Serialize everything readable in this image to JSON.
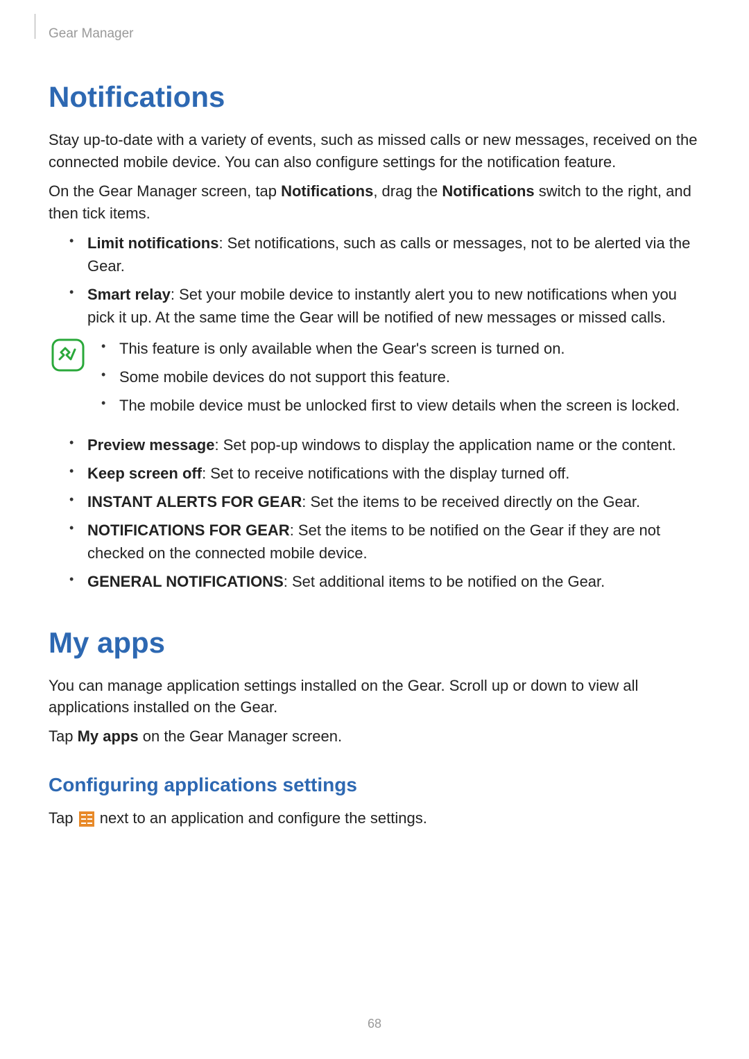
{
  "header": "Gear Manager",
  "pageNumber": "68",
  "notifications": {
    "title": "Notifications",
    "p1": "Stay up-to-date with a variety of events, such as missed calls or new messages, received on the connected mobile device. You can also configure settings for the notification feature.",
    "p2_pre": "On the Gear Manager screen, tap ",
    "p2_b1": "Notifications",
    "p2_mid": ", drag the ",
    "p2_b2": "Notifications",
    "p2_post": " switch to the right, and then tick items.",
    "items1": [
      {
        "label": "Limit notifications",
        "text": ": Set notifications, such as calls or messages, not to be alerted via the Gear."
      },
      {
        "label": "Smart relay",
        "text": ": Set your mobile device to instantly alert you to new notifications when you pick it up. At the same time the Gear will be notified of new messages or missed calls."
      }
    ],
    "note": [
      "This feature is only available when the Gear's screen is turned on.",
      "Some mobile devices do not support this feature.",
      "The mobile device must be unlocked first to view details when the screen is locked."
    ],
    "items2": [
      {
        "label": "Preview message",
        "text": ": Set pop-up windows to display the application name or the content."
      },
      {
        "label": "Keep screen off",
        "text": ": Set to receive notifications with the display turned off."
      },
      {
        "label": "INSTANT ALERTS FOR GEAR",
        "text": ": Set the items to be received directly on the Gear."
      },
      {
        "label": "NOTIFICATIONS FOR GEAR",
        "text": ": Set the items to be notified on the Gear if they are not checked on the connected mobile device."
      },
      {
        "label": "GENERAL NOTIFICATIONS",
        "text": ": Set additional items to be notified on the Gear."
      }
    ]
  },
  "myapps": {
    "title": "My apps",
    "p1": "You can manage application settings installed on the Gear. Scroll up or down to view all applications installed on the Gear.",
    "p2_pre": "Tap ",
    "p2_b": "My apps",
    "p2_post": " on the Gear Manager screen.",
    "subheading": "Configuring applications settings",
    "p3_pre": "Tap ",
    "p3_post": " next to an application and configure the settings."
  }
}
